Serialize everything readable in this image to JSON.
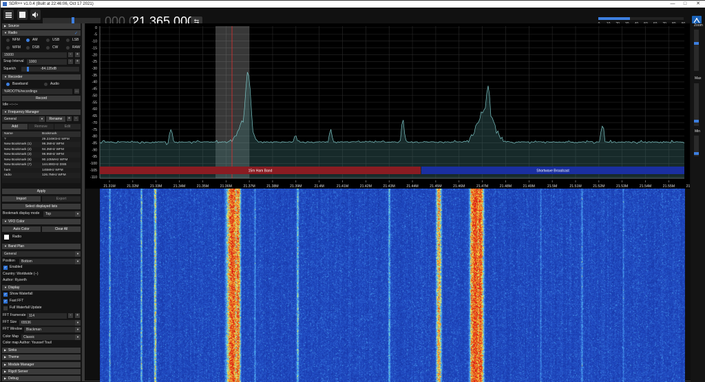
{
  "window": {
    "title": "SDR++ v1.0.4 (Built at 22:46:06, Oct 17 2021)",
    "buttons": [
      "—",
      "□",
      "✕"
    ]
  },
  "toolbar": {
    "freq_dim": "000.0",
    "freq_main": "21.365.000",
    "swap_icon": "⇆",
    "snr_ticks": [
      "0",
      "10",
      "20",
      "30",
      "40",
      "50",
      "60",
      "70",
      "80",
      "90"
    ],
    "volume": 0.52,
    "snr_level": 0.37
  },
  "sidebar": {
    "source": "Source",
    "radio": "Radio",
    "modes": [
      [
        "NFM",
        "AM",
        "USB",
        "LSB"
      ],
      [
        "WFM",
        "DSB",
        "CW",
        "RAW"
      ]
    ],
    "selected_mode": "AM",
    "bandwidth": "15000",
    "snap_label": "Snap Interval",
    "snap_value": "1000",
    "squelch_label": "Squelch",
    "squelch_value": "-84.135dB",
    "recorder": "Recorder",
    "baseband": "Baseband",
    "audio": "Audio",
    "rec_path": "%ROOT%/recordings",
    "record": "Record",
    "status": "Idle --:--:--",
    "freq_manager": "Frequency Manager",
    "fm_list": "General",
    "rename": "Rename",
    "add": "Add",
    "remove": "Remove",
    "edit": "Edit",
    "table_headers": [
      "Name",
      "Bookmark"
    ],
    "bookmarks": [
      [
        "?",
        "29.2249GHz WFM"
      ],
      [
        "New Bookmark (1)",
        "96.3MHz WFM"
      ],
      [
        "New Bookmark (2)",
        "94.3MHz WFM"
      ],
      [
        "New Bookmark (3)",
        "96.9MHz WFM"
      ],
      [
        "New Bookmark (6)",
        "90.105MHz WFM"
      ],
      [
        "New Bookmark (7)",
        "144.89GHz DSB"
      ],
      [
        "ham",
        "145MHz WFM"
      ],
      [
        "radio",
        "126.7MHz WFM"
      ]
    ],
    "apply": "Apply",
    "import": "Import",
    "export": "Export",
    "select_displayed": "Select displayed lists",
    "bm_mode_label": "Bookmark display mode",
    "bm_mode_value": "Top",
    "vfo_color": "VFO Color",
    "auto_color": "Auto Color",
    "clear_all": "Clear All",
    "vfo_radio": "Radio",
    "band_plan": "Band Plan",
    "bp_value": "General",
    "position_label": "Position",
    "position_value": "Bottom",
    "enabled": "Enabled",
    "country": "Country: Worldwide (--)",
    "author": "Author: Ryzerth",
    "display": "Display",
    "show_wf": "Show Waterfall",
    "fast_fft": "Fast FFT",
    "full_wf": "Full Waterfall Update",
    "fft_rate_label": "FFT Framerate",
    "fft_rate": "114",
    "fft_size_label": "FFT Size",
    "fft_size": "65536",
    "fft_window_label": "FFT Window",
    "fft_window": "Blackman",
    "cmap_label": "Color Map",
    "cmap": "Classic",
    "cmap_author": "Color map Author: Youssef Touil",
    "sinks": "Sinks",
    "theme": "Theme",
    "module_manager": "Module Manager",
    "rigctl": "Rigctl Server",
    "debug": "Debug"
  },
  "fft": {
    "db_ticks": [
      "0",
      "-5",
      "-10",
      "-15",
      "-20",
      "-25",
      "-30",
      "-35",
      "-40",
      "-45",
      "-50",
      "-55",
      "-60",
      "-65",
      "-70",
      "-75",
      "-80",
      "-85",
      "-90",
      "-95",
      "-100",
      "-105",
      "-110"
    ],
    "freq_ticks": [
      "21.31M",
      "21.32M",
      "21.33M",
      "21.34M",
      "21.35M",
      "21.36M",
      "21.37M",
      "21.38M",
      "21.39M",
      "21.4M",
      "21.41M",
      "21.42M",
      "21.43M",
      "21.44M",
      "21.45M",
      "21.46M",
      "21.47M",
      "21.48M",
      "21.49M",
      "21.5M",
      "21.51M",
      "21.52M",
      "21.53M",
      "21.54M",
      "21.55M",
      "21.56M"
    ],
    "bands": [
      {
        "name": "15m Ham Band",
        "color": "#8a1c22"
      },
      {
        "name": "Shortwave Broadcast",
        "color": "#1a2fa0"
      }
    ]
  },
  "zoom": {
    "zoom": "Zoom",
    "max": "Max",
    "min": "Min"
  }
}
